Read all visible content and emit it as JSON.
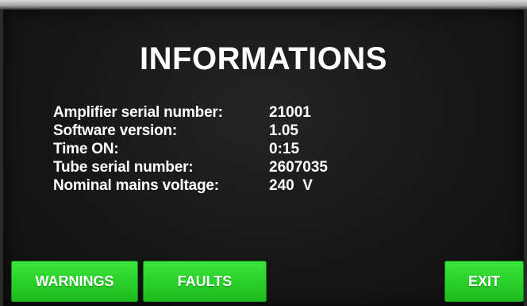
{
  "screen": {
    "title": "INFORMATIONS"
  },
  "info": {
    "rows": [
      {
        "label": "Amplifier serial number:",
        "value": "21001"
      },
      {
        "label": "Software version:",
        "value": "1.05"
      },
      {
        "label": "Time ON:",
        "value": "0:15"
      },
      {
        "label": "Tube serial number:",
        "value": "2607035"
      },
      {
        "label": "Nominal mains voltage:",
        "value": "240  V"
      }
    ]
  },
  "buttons": {
    "warnings_label": "WARNINGS",
    "faults_label": "FAULTS",
    "exit_label": "EXIT"
  },
  "colors": {
    "screen_background": "#171717",
    "text": "#ffffff",
    "button_green": "#2bd42b"
  }
}
